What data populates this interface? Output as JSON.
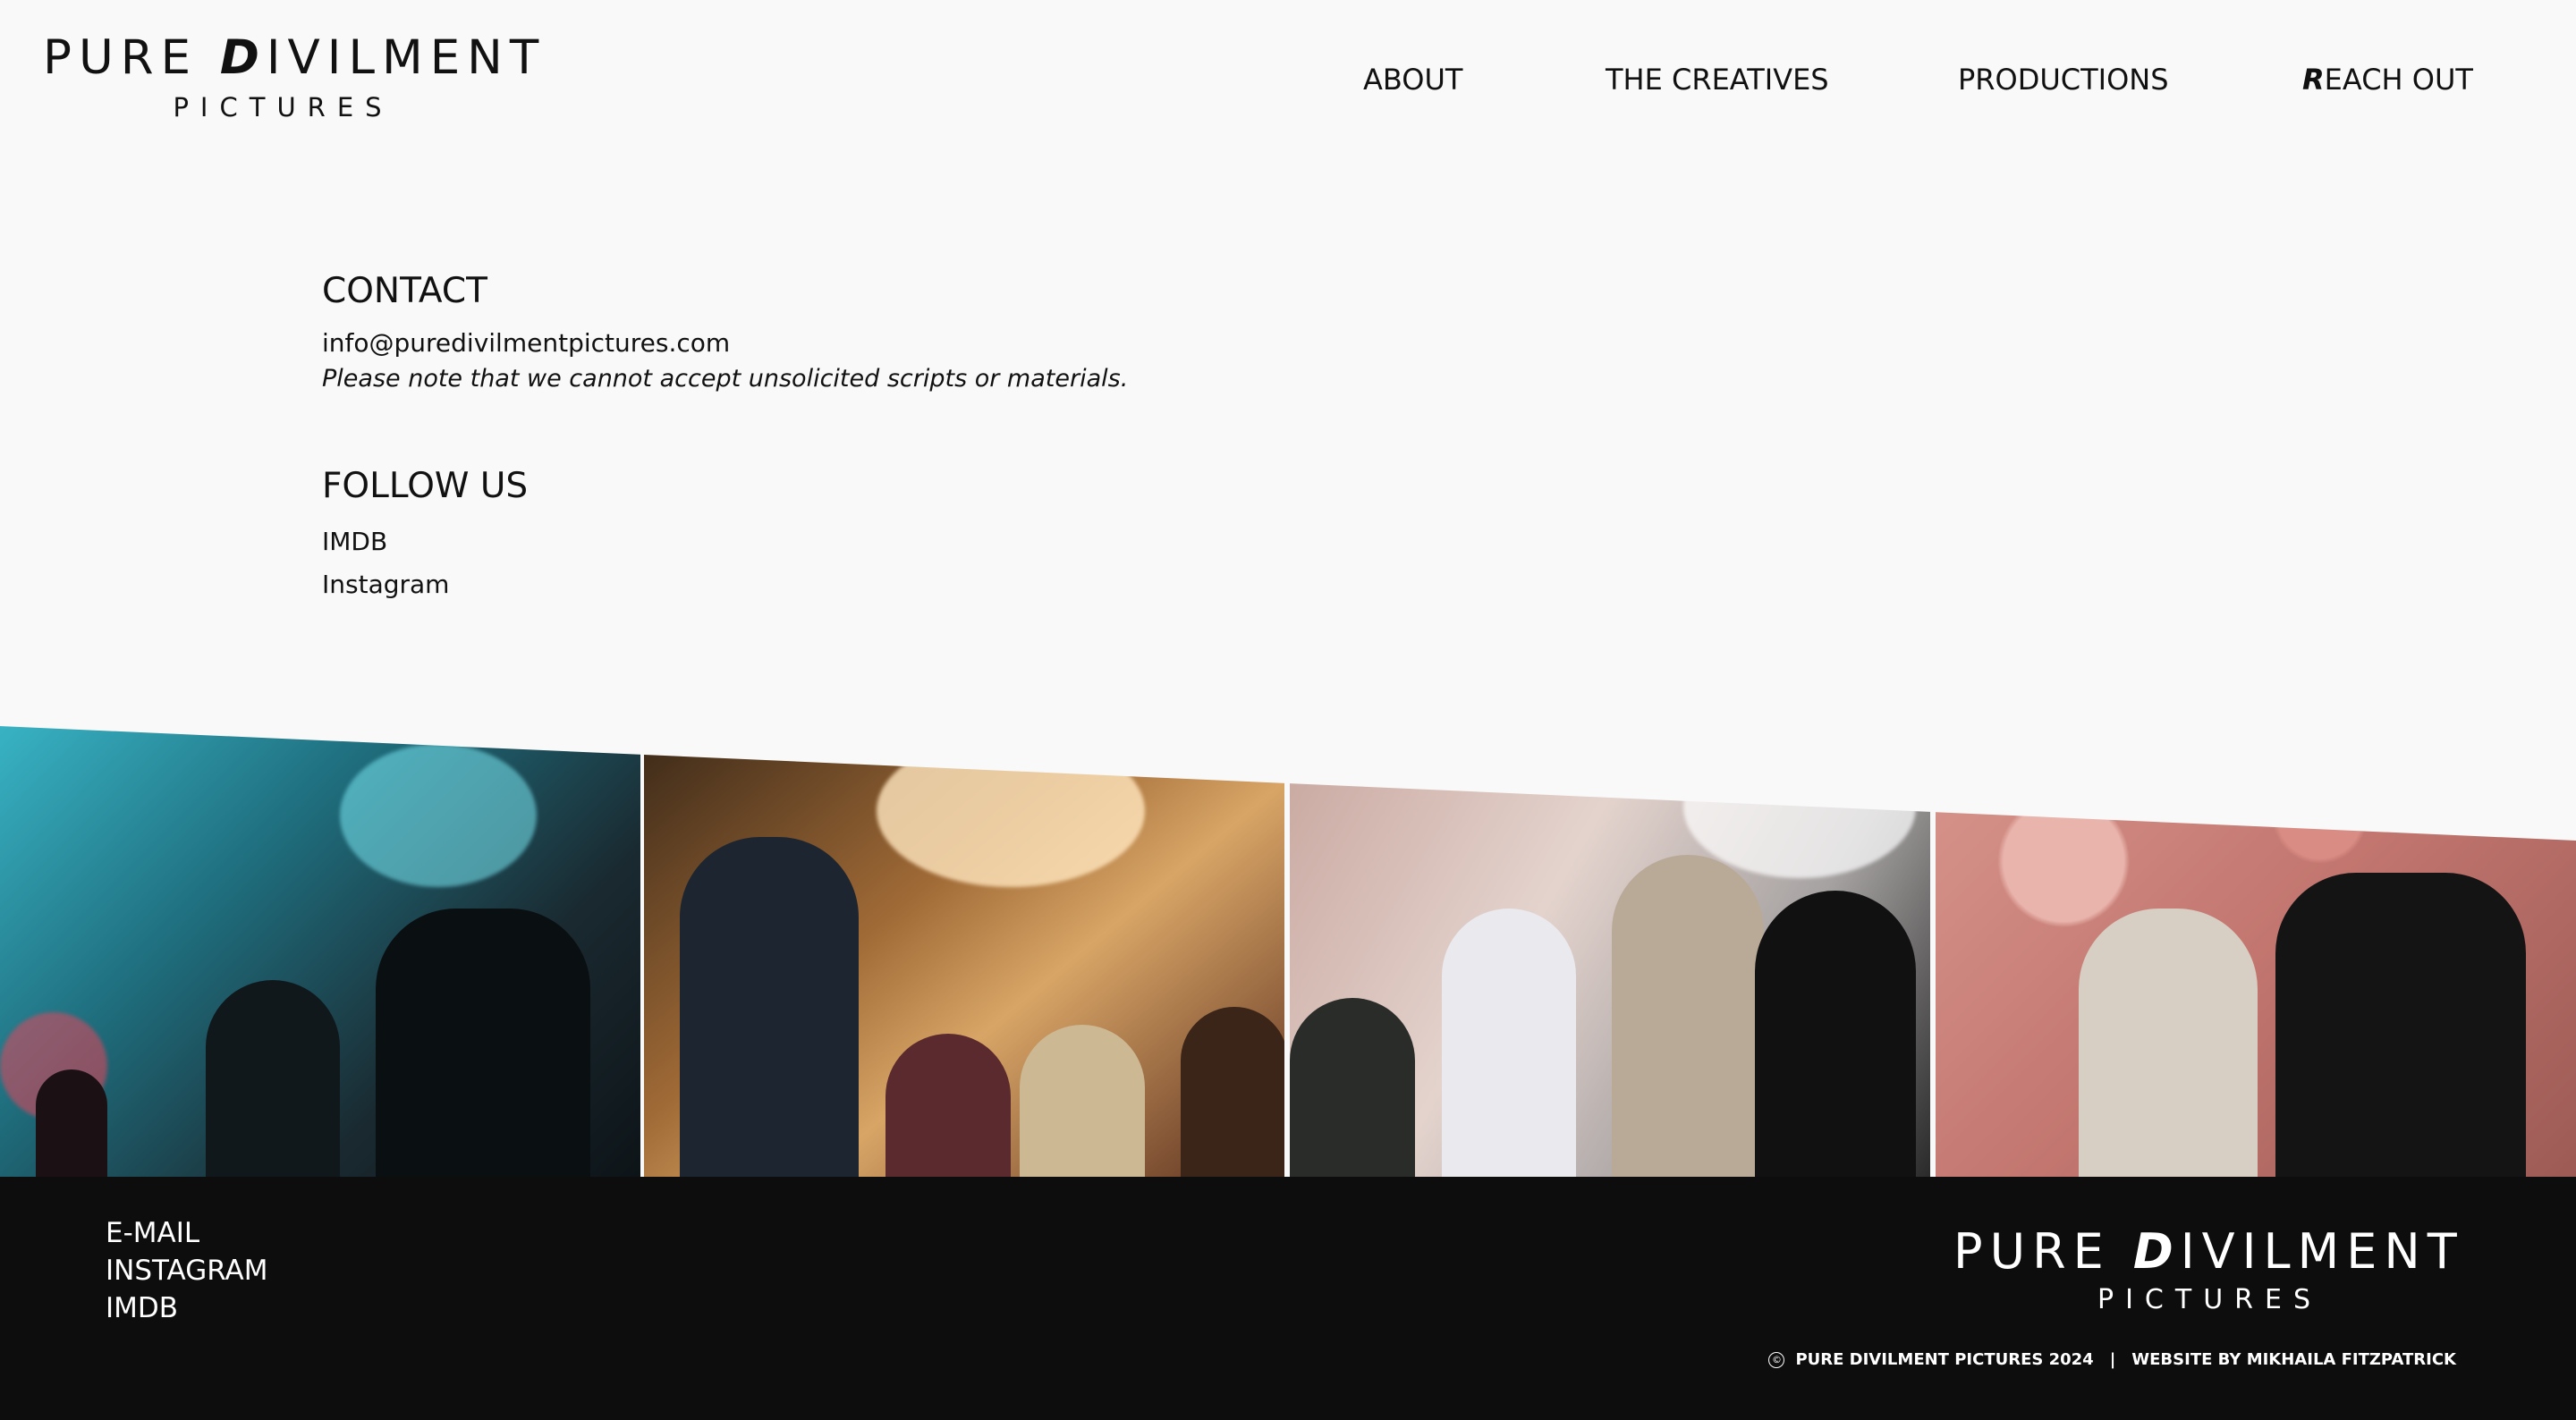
{
  "brand": {
    "name_part1": "PURE ",
    "name_d": "D",
    "name_part2": "IVILMENT",
    "sub": "PICTURES"
  },
  "nav": {
    "about": "ABOUT",
    "creatives": "THE CREATIVES",
    "productions": "PRODUCTIONS",
    "reach_out_first": "R",
    "reach_out_rest": "EACH OUT"
  },
  "contact": {
    "heading": "CONTACT",
    "email": "info@puredivilmentpictures.com",
    "note": "Please note that we cannot accept unsolicited scripts or materials."
  },
  "follow": {
    "heading": "FOLLOW US",
    "links": [
      "IMDB",
      "Instagram"
    ]
  },
  "footer": {
    "links": [
      "E-MAIL",
      "INSTAGRAM",
      "IMDB"
    ],
    "copyright_icon": "©",
    "copyright": "PURE DIVILMENT PICTURES 2024",
    "separator": "|",
    "credit": "WEBSITE BY MIKHAILA FITZPATRICK"
  },
  "colors": {
    "background": "#f9f9f9",
    "text": "#111111",
    "footer_bg": "#0d0d0d",
    "footer_text": "#ffffff"
  },
  "icons": {
    "copyright": "copyright-icon"
  }
}
